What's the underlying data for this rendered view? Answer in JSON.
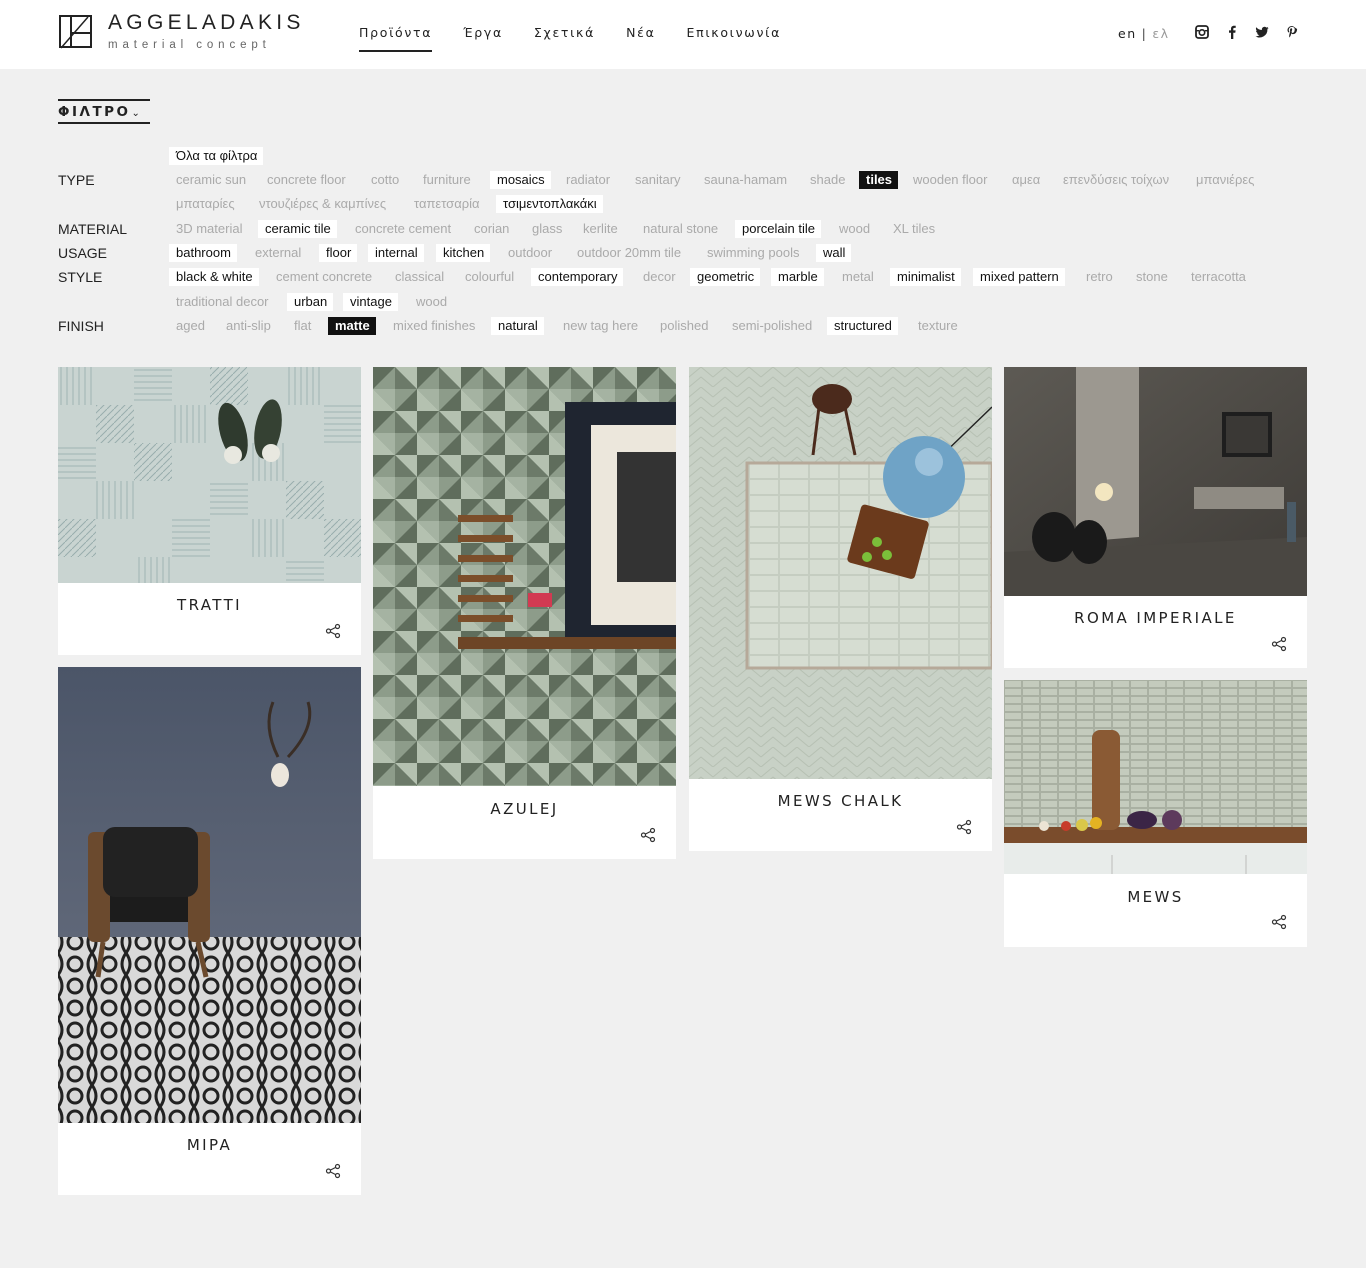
{
  "header": {
    "logo_title": "AGGELADAKIS",
    "logo_subtitle": "material concept",
    "nav": [
      "Προϊόντα",
      "Έργα",
      "Σχετικά",
      "Νέα",
      "Επικοινωνία"
    ],
    "lang_en": "en",
    "lang_sep": "|",
    "lang_el": "ελ",
    "social": [
      "instagram-icon",
      "facebook-icon",
      "twitter-icon",
      "pinterest-icon"
    ]
  },
  "filter": {
    "toggle_label": "ΦΙΛΤΡΟ",
    "toggle_chevron": "⌄",
    "all_filters": "Όλα τα φίλτρα",
    "labels": {
      "type": "TYPE",
      "material": "MATERIAL",
      "usage": "USAGE",
      "style": "STYLE",
      "finish": "FINISH"
    },
    "type": [
      "ceramic sun",
      "concrete floor",
      "cotto",
      "furniture",
      "mosaics",
      "radiator",
      "sanitary",
      "sauna-hamam",
      "shade",
      "tiles",
      "wooden floor",
      "αμεα",
      "επενδύσεις τοίχων",
      "μπανιέρες",
      "μπαταρίες",
      "ντουζιέρες & καμπίνες",
      "ταπετσαρία",
      "τσιμεντοπλακάκι"
    ],
    "material": [
      "3D material",
      "ceramic tile",
      "concrete cement",
      "corian",
      "glass",
      "kerlite",
      "natural stone",
      "porcelain tile",
      "wood",
      "XL tiles"
    ],
    "usage": [
      "bathroom",
      "external",
      "floor",
      "internal",
      "kitchen",
      "outdoor",
      "outdoor 20mm tile",
      "swimming pools",
      "wall"
    ],
    "style": [
      "black & white",
      "cement concrete",
      "classical",
      "colourful",
      "contemporary",
      "decor",
      "geometric",
      "marble",
      "metal",
      "minimalist",
      "mixed pattern",
      "retro",
      "stone",
      "terracotta",
      "traditional decor",
      "urban",
      "vintage",
      "wood"
    ],
    "finish": [
      "aged",
      "anti-slip",
      "flat",
      "matte",
      "mixed finishes",
      "natural",
      "new tag here",
      "polished",
      "semi-polished",
      "structured",
      "texture"
    ]
  },
  "products": [
    {
      "title": "TRATTI"
    },
    {
      "title": "MIPA"
    },
    {
      "title": "AZULEJ"
    },
    {
      "title": "MEWS CHALK"
    },
    {
      "title": "ROMA IMPERIALE"
    },
    {
      "title": "MEWS"
    }
  ],
  "colors": {
    "background": "#f0f0f0",
    "text": "#222222",
    "tag_inactive": "#aaaaaa",
    "tag_selected_bg": "#ffffff",
    "tag_active_bg": "#111111"
  }
}
